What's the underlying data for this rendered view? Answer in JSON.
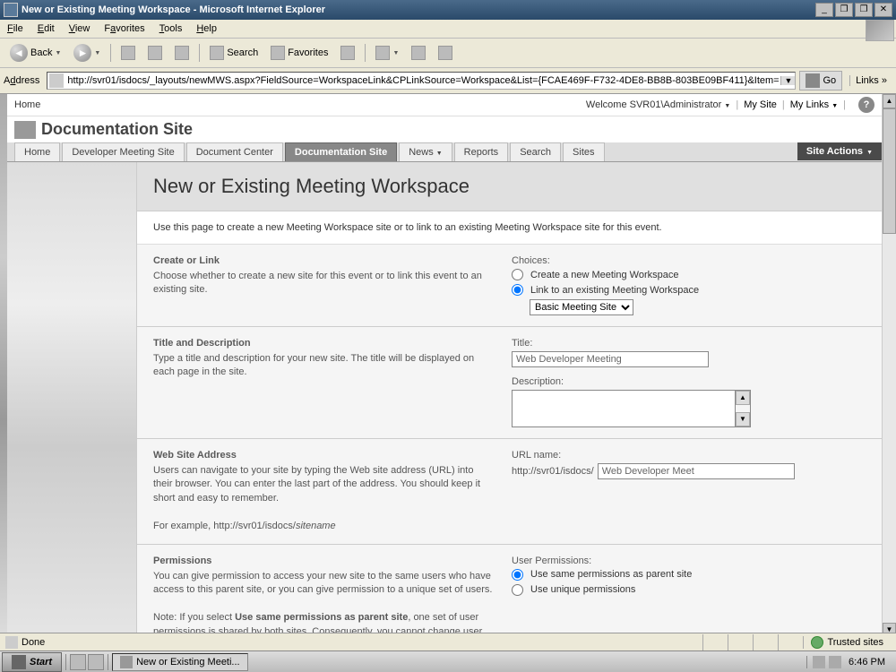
{
  "window": {
    "title": "New or Existing Meeting Workspace - Microsoft Internet Explorer",
    "min": "_",
    "max": "❐",
    "restore": "❐",
    "close": "✕"
  },
  "menu": {
    "file": "File",
    "edit": "Edit",
    "view": "View",
    "favorites": "Favorites",
    "tools": "Tools",
    "help": "Help"
  },
  "toolbar": {
    "back": "Back",
    "search": "Search",
    "favorites": "Favorites"
  },
  "address": {
    "label": "Address",
    "url": "http://svr01/isdocs/_layouts/newMWS.aspx?FieldSource=WorkspaceLink&CPLinkSource=Workspace&List={FCAE469F-F732-4DE8-BB8B-803BE09BF411}&Item=1",
    "go": "Go",
    "links": "Links"
  },
  "sp": {
    "home": "Home",
    "welcome": "Welcome SVR01\\Administrator",
    "mysite": "My Site",
    "mylinks": "My Links",
    "sitename": "Documentation Site",
    "tabs": {
      "home": "Home",
      "dev": "Developer Meeting Site",
      "doccenter": "Document Center",
      "docsite": "Documentation Site",
      "news": "News",
      "reports": "Reports",
      "search": "Search",
      "sites": "Sites"
    },
    "siteactions": "Site Actions"
  },
  "page": {
    "title": "New or Existing Meeting Workspace",
    "desc": "Use this page to create a new Meeting Workspace site or to link to an existing Meeting Workspace site for this event.",
    "s1": {
      "title": "Create or Link",
      "desc": "Choose whether to create a new site for this event or to link this event to an existing site.",
      "choices_label": "Choices:",
      "opt1": "Create a new Meeting Workspace",
      "opt2": "Link to an existing Meeting Workspace",
      "sel_value": "Basic Meeting Site"
    },
    "s2": {
      "title": "Title and Description",
      "desc": "Type a title and description for your new site. The title will be displayed on each page in the site.",
      "title_label": "Title:",
      "title_value": "Web Developer Meeting",
      "desc_label": "Description:",
      "desc_value": ""
    },
    "s3": {
      "title": "Web Site Address",
      "desc1": "Users can navigate to your site by typing the Web site address (URL) into their browser. You can enter the last part of the address. You should keep it short and easy to remember.",
      "desc2a": "For example, http://svr01/isdocs/",
      "desc2b": "sitename",
      "url_label": "URL name:",
      "url_prefix": "http://svr01/isdocs/",
      "url_value": "Web Developer Meet"
    },
    "s4": {
      "title": "Permissions",
      "desc1": "You can give permission to access your new site to the same users who have access to this parent site, or you can give permission to a unique set of users.",
      "desc2a": "Note: If you select ",
      "desc2b": "Use same permissions as parent site",
      "desc2c": ", one set of user permissions is shared by both sites. Consequently, you cannot change user permissions on your new site unless you are an administrator of this parent site.",
      "perm_label": "User Permissions:",
      "opt1": "Use same permissions as parent site",
      "opt2": "Use unique permissions"
    }
  },
  "status": {
    "done": "Done",
    "trusted": "Trusted sites"
  },
  "taskbar": {
    "start": "Start",
    "task": "New or Existing Meeti...",
    "time": "6:46 PM"
  }
}
